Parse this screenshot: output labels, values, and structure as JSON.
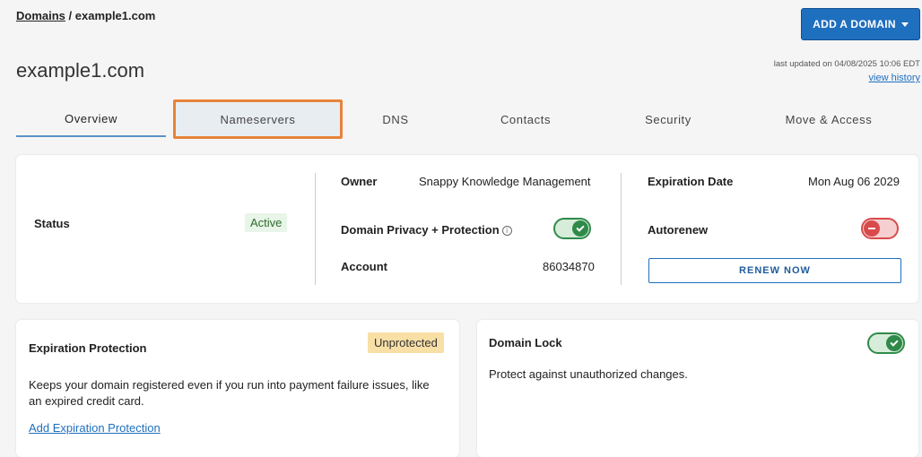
{
  "breadcrumb": {
    "root": "Domains",
    "separator": " / ",
    "current": "example1.com"
  },
  "header": {
    "add_domain_label": "ADD A DOMAIN",
    "title": "example1.com",
    "last_updated": "last updated on 04/08/2025 10:06 EDT",
    "view_history": "view history"
  },
  "tabs": [
    {
      "label": "Overview"
    },
    {
      "label": "Nameservers"
    },
    {
      "label": "DNS"
    },
    {
      "label": "Contacts"
    },
    {
      "label": "Security"
    },
    {
      "label": "Move & Access"
    }
  ],
  "summary": {
    "status_label": "Status",
    "status_value": "Active",
    "owner_label": "Owner",
    "owner_value": "Snappy Knowledge Management",
    "privacy_label": "Domain Privacy + Protection",
    "privacy_enabled": true,
    "account_label": "Account",
    "account_value": "86034870",
    "expiration_label": "Expiration Date",
    "expiration_value": "Mon Aug 06 2029",
    "autorenew_label": "Autorenew",
    "autorenew_enabled": false,
    "renew_label": "RENEW NOW"
  },
  "expiration_protection": {
    "title": "Expiration Protection",
    "badge": "Unprotected",
    "description_line1": "Keeps your domain registered even if you run into payment failure issues, like",
    "description_line2": "an expired credit card.",
    "link": "Add Expiration Protection"
  },
  "domain_lock": {
    "title": "Domain Lock",
    "enabled": true,
    "description": "Protect against unauthorized changes."
  },
  "colors": {
    "accent": "#1f6fbf",
    "highlight_border": "#e8833a",
    "toggle_on": "#2f8a4a",
    "toggle_off": "#d94b4b"
  }
}
